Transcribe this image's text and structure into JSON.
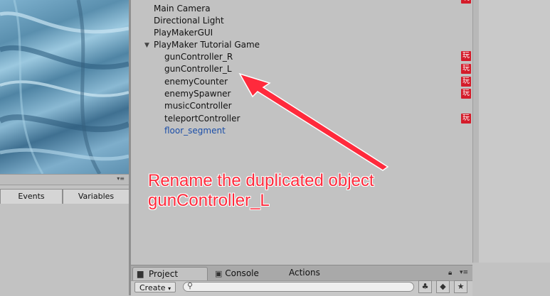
{
  "playmaker": {
    "tabs": [
      {
        "label": "Events"
      },
      {
        "label": "Variables"
      }
    ]
  },
  "hierarchy": {
    "items": [
      {
        "label": "Main Camera"
      },
      {
        "label": "Directional Light"
      },
      {
        "label": "PlayMakerGUI"
      },
      {
        "label": "PlayMaker Tutorial Game"
      },
      {
        "label": "gunController_R"
      },
      {
        "label": "gunController_L"
      },
      {
        "label": "enemyCounter"
      },
      {
        "label": "enemySpawner"
      },
      {
        "label": "musicController"
      },
      {
        "label": "teleportController"
      },
      {
        "label": "floor_segment"
      }
    ],
    "badge_glyph": "玩"
  },
  "annotation": {
    "line1": "Rename the duplicated object",
    "line2": "gunController_L"
  },
  "project": {
    "tabs": [
      {
        "label": "Project"
      },
      {
        "label": "Console"
      },
      {
        "label": "Actions"
      }
    ],
    "create_label": "Create",
    "create_arrow": "▾"
  },
  "colors": {
    "annotation": "#ff2a3c",
    "badge": "#d41c2a",
    "prefab_blue": "#1b4ea8"
  }
}
